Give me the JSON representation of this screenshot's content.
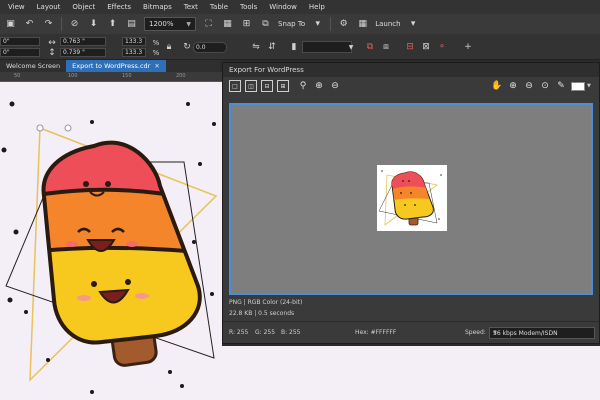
{
  "menu": [
    "View",
    "Layout",
    "Object",
    "Effects",
    "Bitmaps",
    "Text",
    "Table",
    "Tools",
    "Window",
    "Help"
  ],
  "toolbar": {
    "zoom_value": "1200%",
    "snap_label": "Snap To",
    "launch_label": "Launch"
  },
  "propbar": {
    "x_value": "0\"",
    "y_value": "0\"",
    "width_value": "0.763 \"",
    "height_value": "0.739 \"",
    "scale_w": "133.3",
    "scale_h": "133.3",
    "angle_value": "0.0"
  },
  "doc_tabs": [
    {
      "label": "Welcome Screen",
      "active": false
    },
    {
      "label": "Export to WordPress.cdr",
      "active": true
    }
  ],
  "ruler_ticks": [
    "50",
    "100",
    "150",
    "200"
  ],
  "export_dialog": {
    "title": "Export For WordPress",
    "file_info": "PNG  |  RGB Color (24-bit)",
    "size_info": "22.8 KB  |  0.5 seconds",
    "r_label": "R: 255",
    "g_label": "G: 255",
    "b_label": "B: 255",
    "hex_label": "Hex: #FFFFFF",
    "speed_label": "Speed:",
    "speed_value": "56 kbps Modem/ISDN"
  },
  "colors": {
    "accent": "#2d6fb8",
    "canvas_bg": "#f4eef6",
    "preview_bg": "#7e7e7e"
  }
}
